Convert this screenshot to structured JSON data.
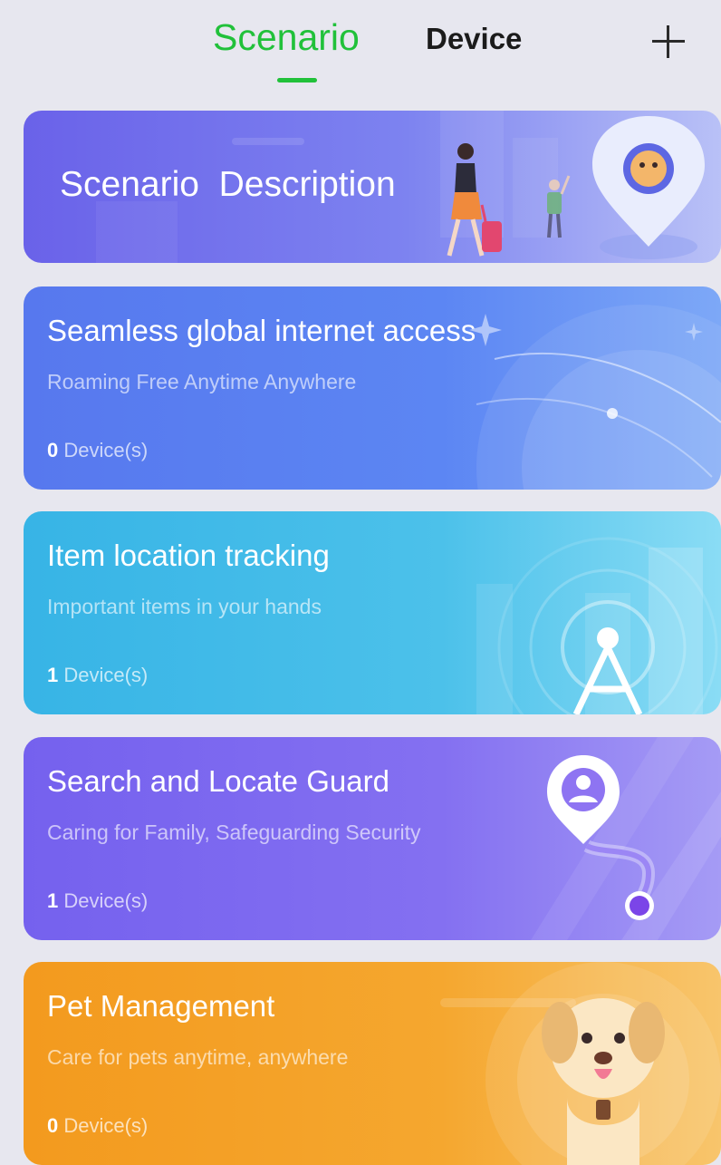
{
  "header": {
    "tabs": [
      {
        "label": "Scenario",
        "active": true
      },
      {
        "label": "Device",
        "active": false
      }
    ],
    "add_icon": "plus-icon",
    "accent_color": "#21c13a"
  },
  "banner": {
    "title": "Scenario  Description"
  },
  "scenarios": [
    {
      "title": "Seamless global internet access",
      "subtitle": "Roaming Free Anytime Anywhere",
      "count": "0",
      "count_suffix": " Device(s)",
      "icon": "globe-icon",
      "color": "#5778ee"
    },
    {
      "title": "Item location tracking",
      "subtitle": "Important items in your hands",
      "count": "1",
      "count_suffix": " Device(s)",
      "icon": "signal-tower-icon",
      "color": "#37b4e6"
    },
    {
      "title": "Search and Locate Guard",
      "subtitle": "Caring for Family, Safeguarding Security",
      "count": "1",
      "count_suffix": " Device(s)",
      "icon": "location-pin-person-icon",
      "color": "#7561ee"
    },
    {
      "title": "Pet Management",
      "subtitle": "Care for pets anytime, anywhere",
      "count": "0",
      "count_suffix": " Device(s)",
      "icon": "dog-icon",
      "color": "#f39a1e"
    }
  ]
}
